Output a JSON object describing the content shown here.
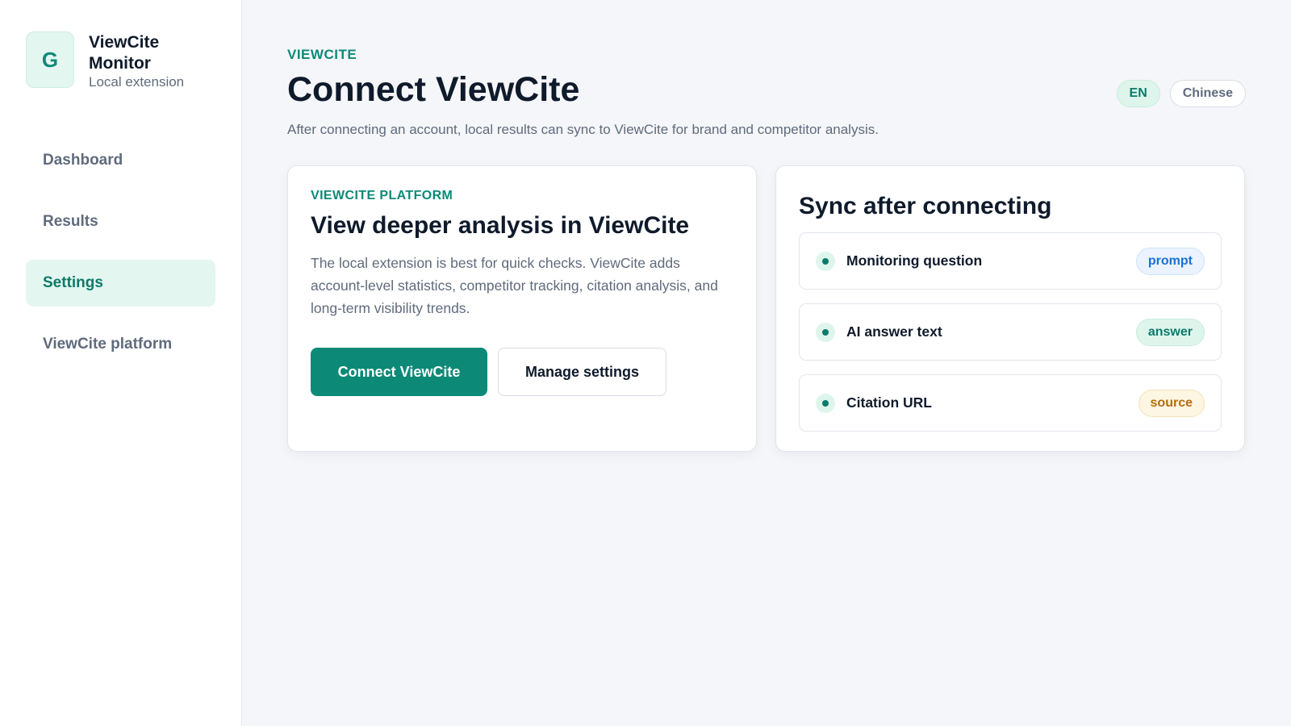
{
  "brand": {
    "logo_letter": "G",
    "name": "ViewCite Monitor",
    "subtitle": "Local extension"
  },
  "nav": {
    "items": [
      {
        "label": "Dashboard",
        "active": false
      },
      {
        "label": "Results",
        "active": false
      },
      {
        "label": "Settings",
        "active": true
      },
      {
        "label": "ViewCite platform",
        "active": false
      }
    ]
  },
  "header": {
    "eyebrow": "VIEWCITE",
    "title": "Connect ViewCite",
    "description": "After connecting an account, local results can sync to ViewCite for brand and competitor analysis."
  },
  "language": {
    "options": [
      "EN",
      "Chinese"
    ],
    "selected": "EN"
  },
  "platform_card": {
    "eyebrow": "VIEWCITE PLATFORM",
    "title": "View deeper analysis in ViewCite",
    "text": "The local extension is best for quick checks. ViewCite adds account-level statistics, competitor tracking, citation analysis, and long-term visibility trends.",
    "primary_button": "Connect ViewCite",
    "secondary_button": "Manage settings"
  },
  "sync_card": {
    "title": "Sync after connecting",
    "items": [
      {
        "label": "Monitoring question",
        "tag": "prompt",
        "tag_color": "#1d6fd6"
      },
      {
        "label": "AI answer text",
        "tag": "answer",
        "tag_color": "#0c7a69"
      },
      {
        "label": "Citation URL",
        "tag": "source",
        "tag_color": "#b86d0b"
      }
    ]
  },
  "colors": {
    "accent": "#0c8a77",
    "active_nav_bg": "#e3f6ef",
    "page_bg": "#f5f6f9"
  }
}
